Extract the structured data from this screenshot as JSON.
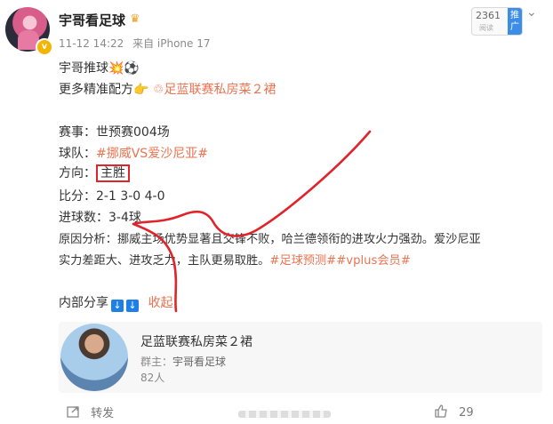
{
  "header": {
    "username": "宇哥看足球",
    "timestamp": "11-12 14:22",
    "source": "来自 iPhone 17",
    "fan_count": "2361",
    "fan_label": "阅读",
    "fan_tag": "推广"
  },
  "post": {
    "line1_text": "宇哥推球",
    "line1_emoji": "💥⚽",
    "line2_text": "更多精准配方",
    "line2_emoji": "👉",
    "line2_link": "足蓝联赛私房菜２裙",
    "match_label": "赛事：",
    "match_value": "世预赛004场",
    "teams_label": "球队：",
    "teams_value": "#挪威VS爱沙尼亚#",
    "direction_label": "方向：",
    "direction_value": "主胜",
    "score_label": "比分：",
    "score_value": "2-1 3-0 4-0",
    "goals_label": "进球数：",
    "goals_value": "3-4球",
    "analysis_label": "原因分析：",
    "analysis_line1": "挪威主场优势显著且交锋不败，哈兰德领衔的进攻火力强劲。爱沙尼亚",
    "analysis_line2": "实力差距大、进攻乏力，主队更易取胜。",
    "analysis_tags": "#足球预测##vplus会员#",
    "share_label": "内部分享",
    "share_arrows": [
      "↓",
      "↓"
    ],
    "collapse_label": "收起"
  },
  "card": {
    "title": "足蓝联赛私房菜２裙",
    "owner_label": "群主：",
    "owner_name": "宇哥看足球",
    "members": "82人"
  },
  "footer": {
    "share_label": "转发",
    "like_count": "29"
  },
  "colors": {
    "link": "#eb7350",
    "highlight_box": "#e0242b",
    "scribble": "#e0242b",
    "share_arrow_bg": "#1e80e6"
  }
}
